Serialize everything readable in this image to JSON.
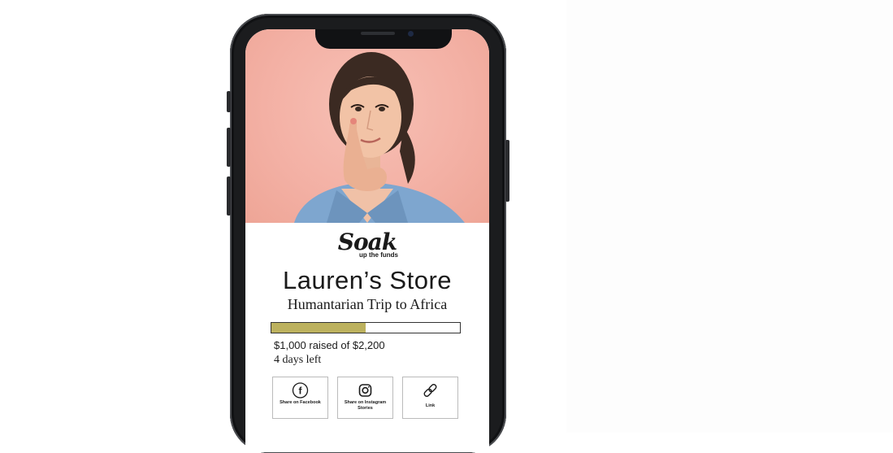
{
  "store": {
    "logo_script": "Soak",
    "logo_subtitle": "up the funds",
    "title": "Lauren’s Store",
    "subtitle": "Humantarian Trip to Africa",
    "raised_text": "$1,000 raised of $2,200",
    "days_left": "4 days left",
    "progress_fraction": 0.5
  },
  "share": {
    "facebook_label": "Share on Facebook",
    "instagram_label": "Share on Instagram Stories",
    "link_label": "Link"
  },
  "colors": {
    "progress_fill": "#bcb15e",
    "hero_background": "#f3b0a4"
  },
  "icons": [
    "facebook-icon",
    "instagram-icon",
    "link-icon"
  ]
}
